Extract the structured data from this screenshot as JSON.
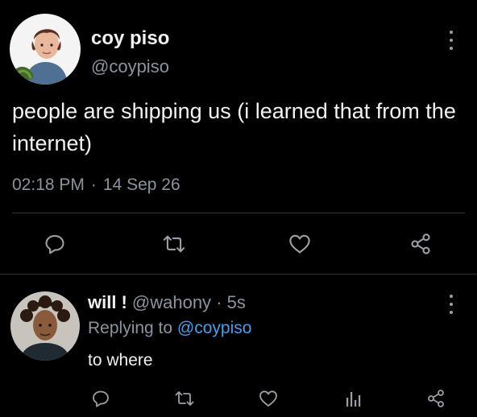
{
  "tweet": {
    "display_name": "coy piso",
    "handle": "@coypiso",
    "text": "people are shipping us (i learned that from the internet)",
    "time": "02:18 PM",
    "separator": "·",
    "date": "14 Sep 26",
    "actions": [
      "comment-icon",
      "retweet-icon",
      "heart-icon",
      "share-icon"
    ]
  },
  "reply": {
    "display_name": "will !",
    "handle": "@wahony",
    "separator": "·",
    "time": "5s",
    "replying_prefix": "Replying to",
    "replying_to": "@coypiso",
    "text": "to where",
    "actions": [
      "comment-icon",
      "retweet-icon",
      "heart-icon",
      "analytics-icon",
      "share-icon"
    ]
  },
  "colors": {
    "background": "#000000",
    "text_primary": "#e7e9ea",
    "text_secondary": "#8b949e",
    "link": "#4e9be8",
    "divider": "#2f3336"
  }
}
